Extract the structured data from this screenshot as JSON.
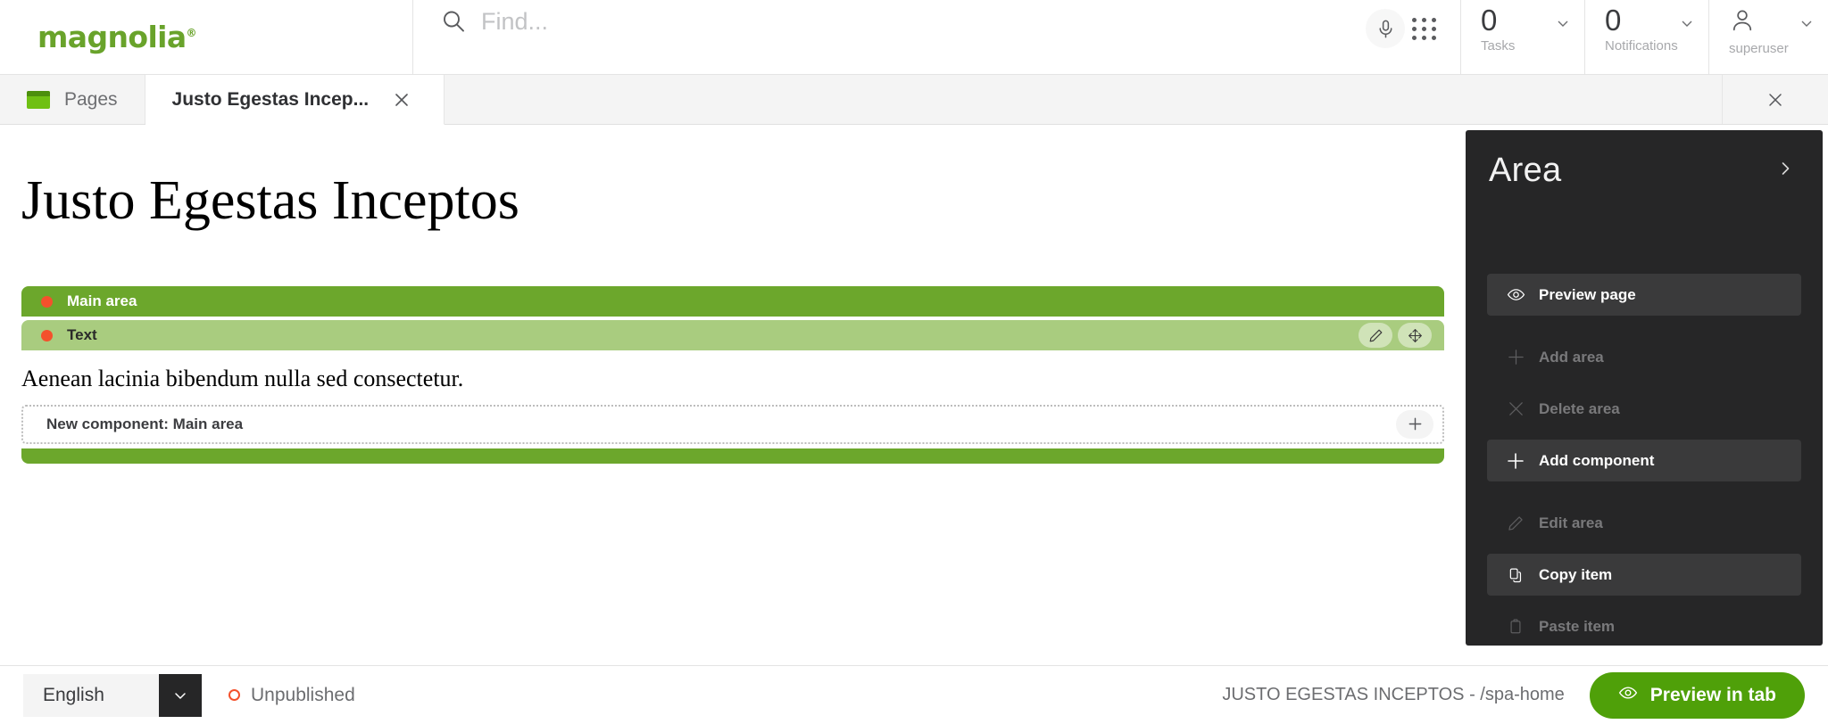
{
  "brand": {
    "name": "magnolia",
    "registered": "®",
    "color": "#69a32b"
  },
  "search": {
    "placeholder": "Find...",
    "value": "",
    "icon": "search-icon"
  },
  "header": {
    "mic_icon": "microphone-icon",
    "apps_icon": "app-grid-icon",
    "tasks": {
      "count": "0",
      "label": "Tasks"
    },
    "notifications": {
      "count": "0",
      "label": "Notifications"
    },
    "user": {
      "name": "superuser",
      "icon": "user-avatar-icon"
    }
  },
  "tabs": {
    "items": [
      {
        "label": "Pages",
        "icon": "pages-icon",
        "active": false,
        "closable": false
      },
      {
        "label": "Justo Egestas Incep...",
        "icon": "",
        "active": true,
        "closable": true
      }
    ],
    "close_all_icon": "close-icon"
  },
  "canvas": {
    "page_title": "Justo Egestas Inceptos",
    "area": {
      "label": "Main area",
      "marker": "status-dot",
      "color": "#6ca72c"
    },
    "component": {
      "label": "Text",
      "marker": "status-dot",
      "color": "#a9cc7f",
      "body_text": "Aenean lacinia bibendum nulla sed consectetur.",
      "actions": [
        {
          "name": "edit-component-icon",
          "title": "Edit"
        },
        {
          "name": "move-component-icon",
          "title": "Move"
        }
      ]
    },
    "new_component": {
      "label": "New component: Main area",
      "add_icon": "plus-icon"
    }
  },
  "panel": {
    "title": "Area",
    "collapse_icon": "chevron-right-icon",
    "preview": {
      "label": "Preview page",
      "icon": "eye-icon",
      "enabled": true
    },
    "groups": [
      {
        "items": [
          {
            "label": "Add area",
            "icon": "plus-icon",
            "enabled": false
          },
          {
            "label": "Delete area",
            "icon": "close-icon",
            "enabled": false
          },
          {
            "label": "Add component",
            "icon": "plus-icon",
            "enabled": true
          }
        ]
      },
      {
        "items": [
          {
            "label": "Edit area",
            "icon": "pencil-icon",
            "enabled": false
          },
          {
            "label": "Copy item",
            "icon": "copy-icon",
            "enabled": true
          },
          {
            "label": "Paste item",
            "icon": "clipboard-icon",
            "enabled": false
          }
        ]
      }
    ]
  },
  "footer": {
    "language": {
      "value": "English",
      "chevron_icon": "chevron-down-icon"
    },
    "status": {
      "text": "Unpublished",
      "color": "#f4512c",
      "icon": "status-ring-icon"
    },
    "page_path": "JUSTO EGESTAS INCEPTOS - /spa-home",
    "preview_button": {
      "label": "Preview in tab",
      "icon": "eye-icon",
      "color": "#4fa009"
    }
  }
}
